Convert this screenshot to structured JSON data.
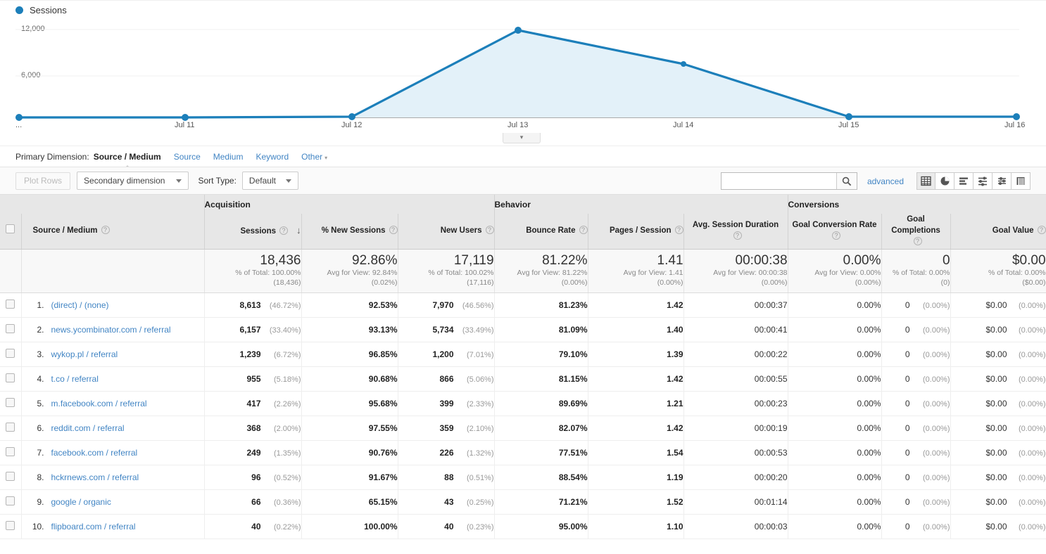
{
  "chart": {
    "legend_label": "Sessions",
    "legend_color": "#1c7fba",
    "expander_icon": "chevron-down-icon"
  },
  "chart_data": {
    "type": "area",
    "title": "Sessions",
    "xlabel": "",
    "ylabel": "",
    "ylim": [
      0,
      14000
    ],
    "ytick_labels": [
      "12,000",
      "6,000"
    ],
    "ytick_values": [
      12000,
      6000
    ],
    "grid": true,
    "legend_position": "top-left",
    "x": [
      "...",
      "Jul 11",
      "Jul 12",
      "Jul 13",
      "Jul 14",
      "Jul 15",
      "Jul 16"
    ],
    "series": [
      {
        "name": "Sessions",
        "color": "#1c7fba",
        "fill": "#e3f1f9",
        "values": [
          10,
          12,
          15,
          11700,
          7450,
          30,
          25
        ]
      }
    ]
  },
  "primary_dimension": {
    "label": "Primary Dimension:",
    "active": "Source / Medium",
    "links": [
      "Source",
      "Medium",
      "Keyword"
    ],
    "other": "Other",
    "other_arrow": "chevron-down-icon"
  },
  "toolbar": {
    "plot_rows": "Plot Rows",
    "secondary_dimension": "Secondary dimension",
    "sort_type_label": "Sort Type:",
    "sort_type_value": "Default",
    "search_placeholder": "",
    "search_value": "",
    "search_icon": "search-icon",
    "advanced": "advanced",
    "view_icons": [
      {
        "name": "table-view-icon",
        "active": true
      },
      {
        "name": "pie-chart-view-icon",
        "active": false
      },
      {
        "name": "bar-chart-view-icon",
        "active": false
      },
      {
        "name": "performance-view-icon",
        "active": false
      },
      {
        "name": "comparison-view-icon",
        "active": false
      },
      {
        "name": "pivot-view-icon",
        "active": false
      }
    ]
  },
  "table": {
    "groups": [
      {
        "label": "",
        "span": 2
      },
      {
        "label": "Acquisition",
        "span": 3
      },
      {
        "label": "Behavior",
        "span": 3
      },
      {
        "label": "Conversions",
        "span": 3
      }
    ],
    "columns": [
      {
        "label": "Source / Medium",
        "help": "?"
      },
      {
        "label": "Sessions",
        "help": "?",
        "sorted": true,
        "sort_arrow": "↓"
      },
      {
        "label": "% New Sessions",
        "help": "?"
      },
      {
        "label": "New Users",
        "help": "?"
      },
      {
        "label": "Bounce Rate",
        "help": "?"
      },
      {
        "label": "Pages / Session",
        "help": "?"
      },
      {
        "label": "Avg. Session Duration",
        "help": "?"
      },
      {
        "label": "Goal Conversion Rate",
        "help": "?"
      },
      {
        "label": "Goal Completions",
        "help": "?"
      },
      {
        "label": "Goal Value",
        "help": "?"
      }
    ],
    "totals": {
      "sessions": {
        "value": "18,436",
        "line1": "% of Total: 100.00%",
        "line2": "(18,436)"
      },
      "pct_new_sessions": {
        "value": "92.86%",
        "line1": "Avg for View: 92.84%",
        "line2": "(0.02%)"
      },
      "new_users": {
        "value": "17,119",
        "line1": "% of Total: 100.02%",
        "line2": "(17,116)"
      },
      "bounce_rate": {
        "value": "81.22%",
        "line1": "Avg for View: 81.22%",
        "line2": "(0.00%)"
      },
      "pages_session": {
        "value": "1.41",
        "line1": "Avg for View: 1.41",
        "line2": "(0.00%)"
      },
      "avg_duration": {
        "value": "00:00:38",
        "line1": "Avg for View: 00:00:38",
        "line2": "(0.00%)"
      },
      "goal_conv_rate": {
        "value": "0.00%",
        "line1": "Avg for View: 0.00%",
        "line2": "(0.00%)"
      },
      "goal_completions": {
        "value": "0",
        "line1": "% of Total: 0.00%",
        "line2": "(0)"
      },
      "goal_value": {
        "value": "$0.00",
        "line1": "% of Total: 0.00%",
        "line2": "($0.00)"
      }
    },
    "rows": [
      {
        "index": "1.",
        "dimension": "(direct) / (none)",
        "sessions": "8,613",
        "sessions_pct": "(46.72%)",
        "pct_new": "92.53%",
        "new_users": "7,970",
        "new_users_pct": "(46.56%)",
        "bounce": "81.23%",
        "pages": "1.42",
        "duration": "00:00:37",
        "conv_rate": "0.00%",
        "completions": "0",
        "completions_pct": "(0.00%)",
        "goal_value": "$0.00",
        "goal_value_pct": "(0.00%)"
      },
      {
        "index": "2.",
        "dimension": "news.ycombinator.com / referral",
        "sessions": "6,157",
        "sessions_pct": "(33.40%)",
        "pct_new": "93.13%",
        "new_users": "5,734",
        "new_users_pct": "(33.49%)",
        "bounce": "81.09%",
        "pages": "1.40",
        "duration": "00:00:41",
        "conv_rate": "0.00%",
        "completions": "0",
        "completions_pct": "(0.00%)",
        "goal_value": "$0.00",
        "goal_value_pct": "(0.00%)"
      },
      {
        "index": "3.",
        "dimension": "wykop.pl / referral",
        "sessions": "1,239",
        "sessions_pct": "(6.72%)",
        "pct_new": "96.85%",
        "new_users": "1,200",
        "new_users_pct": "(7.01%)",
        "bounce": "79.10%",
        "pages": "1.39",
        "duration": "00:00:22",
        "conv_rate": "0.00%",
        "completions": "0",
        "completions_pct": "(0.00%)",
        "goal_value": "$0.00",
        "goal_value_pct": "(0.00%)"
      },
      {
        "index": "4.",
        "dimension": "t.co / referral",
        "sessions": "955",
        "sessions_pct": "(5.18%)",
        "pct_new": "90.68%",
        "new_users": "866",
        "new_users_pct": "(5.06%)",
        "bounce": "81.15%",
        "pages": "1.42",
        "duration": "00:00:55",
        "conv_rate": "0.00%",
        "completions": "0",
        "completions_pct": "(0.00%)",
        "goal_value": "$0.00",
        "goal_value_pct": "(0.00%)"
      },
      {
        "index": "5.",
        "dimension": "m.facebook.com / referral",
        "sessions": "417",
        "sessions_pct": "(2.26%)",
        "pct_new": "95.68%",
        "new_users": "399",
        "new_users_pct": "(2.33%)",
        "bounce": "89.69%",
        "pages": "1.21",
        "duration": "00:00:23",
        "conv_rate": "0.00%",
        "completions": "0",
        "completions_pct": "(0.00%)",
        "goal_value": "$0.00",
        "goal_value_pct": "(0.00%)"
      },
      {
        "index": "6.",
        "dimension": "reddit.com / referral",
        "sessions": "368",
        "sessions_pct": "(2.00%)",
        "pct_new": "97.55%",
        "new_users": "359",
        "new_users_pct": "(2.10%)",
        "bounce": "82.07%",
        "pages": "1.42",
        "duration": "00:00:19",
        "conv_rate": "0.00%",
        "completions": "0",
        "completions_pct": "(0.00%)",
        "goal_value": "$0.00",
        "goal_value_pct": "(0.00%)"
      },
      {
        "index": "7.",
        "dimension": "facebook.com / referral",
        "sessions": "249",
        "sessions_pct": "(1.35%)",
        "pct_new": "90.76%",
        "new_users": "226",
        "new_users_pct": "(1.32%)",
        "bounce": "77.51%",
        "pages": "1.54",
        "duration": "00:00:53",
        "conv_rate": "0.00%",
        "completions": "0",
        "completions_pct": "(0.00%)",
        "goal_value": "$0.00",
        "goal_value_pct": "(0.00%)"
      },
      {
        "index": "8.",
        "dimension": "hckrnews.com / referral",
        "sessions": "96",
        "sessions_pct": "(0.52%)",
        "pct_new": "91.67%",
        "new_users": "88",
        "new_users_pct": "(0.51%)",
        "bounce": "88.54%",
        "pages": "1.19",
        "duration": "00:00:20",
        "conv_rate": "0.00%",
        "completions": "0",
        "completions_pct": "(0.00%)",
        "goal_value": "$0.00",
        "goal_value_pct": "(0.00%)"
      },
      {
        "index": "9.",
        "dimension": "google / organic",
        "sessions": "66",
        "sessions_pct": "(0.36%)",
        "pct_new": "65.15%",
        "new_users": "43",
        "new_users_pct": "(0.25%)",
        "bounce": "71.21%",
        "pages": "1.52",
        "duration": "00:01:14",
        "conv_rate": "0.00%",
        "completions": "0",
        "completions_pct": "(0.00%)",
        "goal_value": "$0.00",
        "goal_value_pct": "(0.00%)"
      },
      {
        "index": "10.",
        "dimension": "flipboard.com / referral",
        "sessions": "40",
        "sessions_pct": "(0.22%)",
        "pct_new": "100.00%",
        "new_users": "40",
        "new_users_pct": "(0.23%)",
        "bounce": "95.00%",
        "pages": "1.10",
        "duration": "00:00:03",
        "conv_rate": "0.00%",
        "completions": "0",
        "completions_pct": "(0.00%)",
        "goal_value": "$0.00",
        "goal_value_pct": "(0.00%)"
      }
    ]
  }
}
